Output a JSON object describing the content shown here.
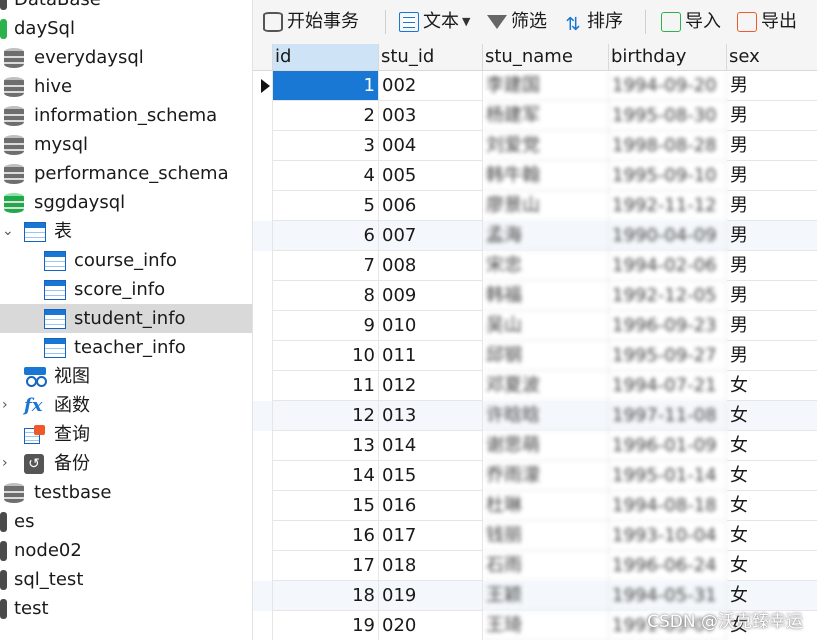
{
  "sidebar": {
    "items": [
      {
        "label": "DataBase",
        "icon": "connection-icon",
        "level": 0
      },
      {
        "label": "daySql",
        "icon": "connection-icon-green",
        "level": 0
      },
      {
        "label": "everydaysql",
        "icon": "database-icon",
        "level": 1
      },
      {
        "label": "hive",
        "icon": "database-icon",
        "level": 1
      },
      {
        "label": "information_schema",
        "icon": "database-icon",
        "level": 1
      },
      {
        "label": "mysql",
        "icon": "database-icon",
        "level": 1
      },
      {
        "label": "performance_schema",
        "icon": "database-icon",
        "level": 1
      },
      {
        "label": "sggdaysql",
        "icon": "database-icon-green",
        "level": 1
      },
      {
        "label": "表",
        "icon": "table-folder-icon",
        "level": 2,
        "expanded": true
      },
      {
        "label": "course_info",
        "icon": "table-icon",
        "level": 3
      },
      {
        "label": "score_info",
        "icon": "table-icon",
        "level": 3
      },
      {
        "label": "student_info",
        "icon": "table-icon",
        "level": 3,
        "selected": true
      },
      {
        "label": "teacher_info",
        "icon": "table-icon",
        "level": 3
      },
      {
        "label": "视图",
        "icon": "view-icon",
        "level": 2
      },
      {
        "label": "函数",
        "icon": "function-icon",
        "level": 2,
        "collapsible": true
      },
      {
        "label": "查询",
        "icon": "query-icon",
        "level": 2
      },
      {
        "label": "备份",
        "icon": "backup-icon",
        "level": 2,
        "collapsible": true
      },
      {
        "label": "testbase",
        "icon": "database-icon",
        "level": 1
      },
      {
        "label": "es",
        "icon": "connection-icon",
        "level": 0
      },
      {
        "label": "node02",
        "icon": "connection-icon",
        "level": 0
      },
      {
        "label": "sql_test",
        "icon": "connection-icon",
        "level": 0
      },
      {
        "label": "test",
        "icon": "connection-icon",
        "level": 0
      }
    ]
  },
  "toolbar": {
    "begin_transaction": "开始事务",
    "text": "文本",
    "filter": "筛选",
    "sort": "排序",
    "import": "导入",
    "export": "导出"
  },
  "grid": {
    "columns": [
      "id",
      "stu_id",
      "stu_name",
      "birthday",
      "sex"
    ],
    "rows": [
      {
        "id": "1",
        "stu_id": "002",
        "stu_name": "李建国",
        "birthday": "1994-09-20",
        "sex": "男"
      },
      {
        "id": "2",
        "stu_id": "003",
        "stu_name": "杨建军",
        "birthday": "1995-08-30",
        "sex": "男"
      },
      {
        "id": "3",
        "stu_id": "004",
        "stu_name": "刘爱党",
        "birthday": "1998-08-28",
        "sex": "男"
      },
      {
        "id": "4",
        "stu_id": "005",
        "stu_name": "韩牛翰",
        "birthday": "1995-09-10",
        "sex": "男"
      },
      {
        "id": "5",
        "stu_id": "006",
        "stu_name": "廖景山",
        "birthday": "1992-11-12",
        "sex": "男"
      },
      {
        "id": "6",
        "stu_id": "007",
        "stu_name": "孟海",
        "birthday": "1990-04-09",
        "sex": "男"
      },
      {
        "id": "7",
        "stu_id": "008",
        "stu_name": "宋忠",
        "birthday": "1994-02-06",
        "sex": "男"
      },
      {
        "id": "8",
        "stu_id": "009",
        "stu_name": "韩福",
        "birthday": "1992-12-05",
        "sex": "男"
      },
      {
        "id": "9",
        "stu_id": "010",
        "stu_name": "吴山",
        "birthday": "1996-09-23",
        "sex": "男"
      },
      {
        "id": "10",
        "stu_id": "011",
        "stu_name": "邱钢",
        "birthday": "1995-09-27",
        "sex": "男"
      },
      {
        "id": "11",
        "stu_id": "012",
        "stu_name": "邓夏波",
        "birthday": "1994-07-21",
        "sex": "女"
      },
      {
        "id": "12",
        "stu_id": "013",
        "stu_name": "许晗晗",
        "birthday": "1997-11-08",
        "sex": "女"
      },
      {
        "id": "13",
        "stu_id": "014",
        "stu_name": "谢思萌",
        "birthday": "1996-01-09",
        "sex": "女"
      },
      {
        "id": "14",
        "stu_id": "015",
        "stu_name": "乔雨濛",
        "birthday": "1995-01-14",
        "sex": "女"
      },
      {
        "id": "15",
        "stu_id": "016",
        "stu_name": "杜琳",
        "birthday": "1994-08-18",
        "sex": "女"
      },
      {
        "id": "16",
        "stu_id": "017",
        "stu_name": "钱丽",
        "birthday": "1993-10-04",
        "sex": "女"
      },
      {
        "id": "17",
        "stu_id": "018",
        "stu_name": "石雨",
        "birthday": "1996-06-24",
        "sex": "女"
      },
      {
        "id": "18",
        "stu_id": "019",
        "stu_name": "王颖",
        "birthday": "1994-05-31",
        "sex": "女"
      },
      {
        "id": "19",
        "stu_id": "020",
        "stu_name": "王琦",
        "birthday": "1991-03-07",
        "sex": "女"
      }
    ]
  },
  "watermark": "CSDN @沃克臻幸运",
  "colors": {
    "selection": "#1978d4",
    "header_active": "#cfe3f7",
    "tree_selected": "#d9d9d9",
    "accent_blue": "#1976d2",
    "db_green": "#1faa4a"
  }
}
